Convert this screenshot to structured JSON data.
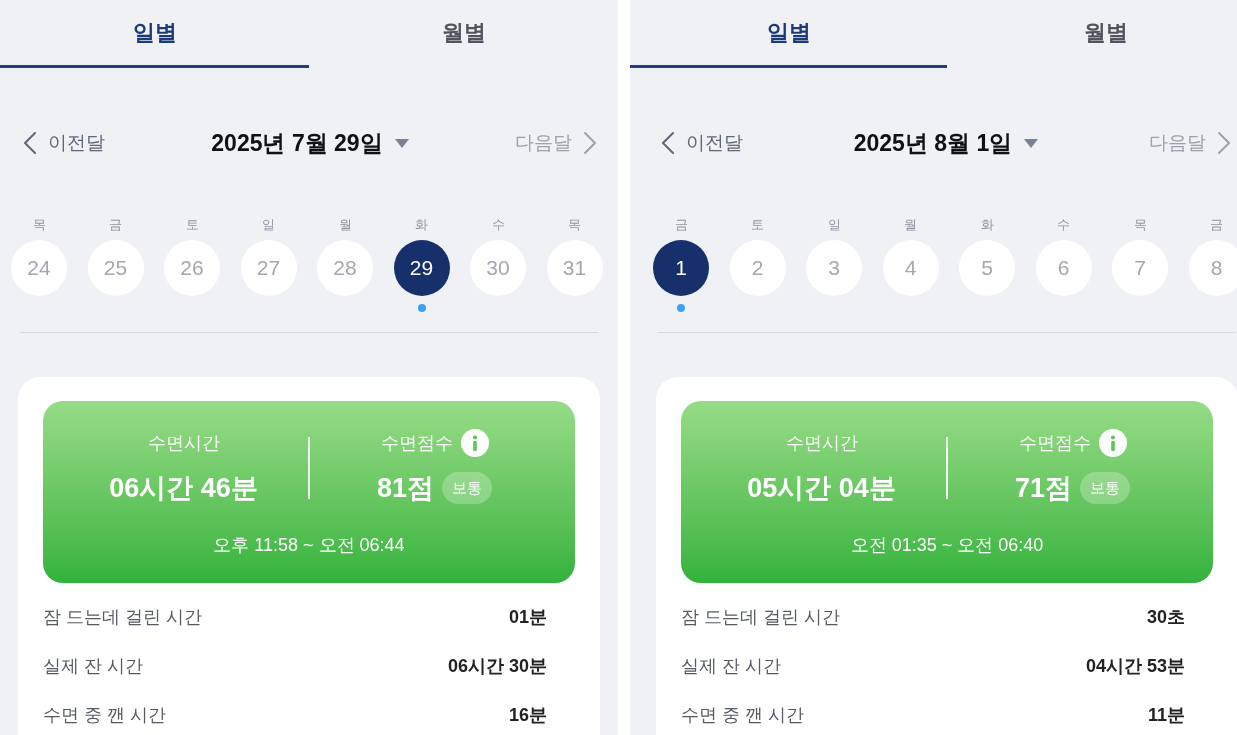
{
  "panels": [
    {
      "tabs": [
        {
          "label": "일별",
          "selected": true
        },
        {
          "label": "월별",
          "selected": false
        }
      ],
      "nav": {
        "prev": {
          "label": "이전달",
          "disabled": false
        },
        "title": "2025년 7월 29일",
        "next": {
          "label": "다음달",
          "disabled": true
        }
      },
      "days": [
        {
          "weekday": "목",
          "day": "24",
          "selected": false,
          "marked": false
        },
        {
          "weekday": "금",
          "day": "25",
          "selected": false,
          "marked": false
        },
        {
          "weekday": "토",
          "day": "26",
          "selected": false,
          "marked": false
        },
        {
          "weekday": "일",
          "day": "27",
          "selected": false,
          "marked": false
        },
        {
          "weekday": "월",
          "day": "28",
          "selected": false,
          "marked": false
        },
        {
          "weekday": "화",
          "day": "29",
          "selected": true,
          "marked": true
        },
        {
          "weekday": "수",
          "day": "30",
          "selected": false,
          "marked": false
        },
        {
          "weekday": "목",
          "day": "31",
          "selected": false,
          "marked": false
        }
      ],
      "summary": {
        "duration_label": "수면시간",
        "duration": "06시간 46분",
        "score_label": "수면점수",
        "score": "81점",
        "grade": "보통",
        "range": "오후 11:58 ~ 오전 06:44"
      },
      "details": [
        {
          "label": "잠 드는데 걸린 시간",
          "value": "01분"
        },
        {
          "label": "실제 잔 시간",
          "value": "06시간 30분"
        },
        {
          "label": "수면 중 깬 시간",
          "value": "16분"
        }
      ]
    },
    {
      "tabs": [
        {
          "label": "일별",
          "selected": true
        },
        {
          "label": "월별",
          "selected": false
        }
      ],
      "nav": {
        "prev": {
          "label": "이전달",
          "disabled": false
        },
        "title": "2025년 8월 1일",
        "next": {
          "label": "다음달",
          "disabled": true
        }
      },
      "days": [
        {
          "weekday": "금",
          "day": "1",
          "selected": true,
          "marked": true
        },
        {
          "weekday": "토",
          "day": "2",
          "selected": false,
          "marked": false
        },
        {
          "weekday": "일",
          "day": "3",
          "selected": false,
          "marked": false
        },
        {
          "weekday": "월",
          "day": "4",
          "selected": false,
          "marked": false
        },
        {
          "weekday": "화",
          "day": "5",
          "selected": false,
          "marked": false
        },
        {
          "weekday": "수",
          "day": "6",
          "selected": false,
          "marked": false
        },
        {
          "weekday": "목",
          "day": "7",
          "selected": false,
          "marked": false
        },
        {
          "weekday": "금",
          "day": "8",
          "selected": false,
          "marked": false
        }
      ],
      "summary": {
        "duration_label": "수면시간",
        "duration": "05시간 04분",
        "score_label": "수면점수",
        "score": "71점",
        "grade": "보통",
        "range": "오전 01:35 ~ 오전 06:40"
      },
      "details": [
        {
          "label": "잠 드는데 걸린 시간",
          "value": "30초"
        },
        {
          "label": "실제 잔 시간",
          "value": "04시간 53분"
        },
        {
          "label": "수면 중 깬 시간",
          "value": "11분"
        }
      ]
    }
  ]
}
